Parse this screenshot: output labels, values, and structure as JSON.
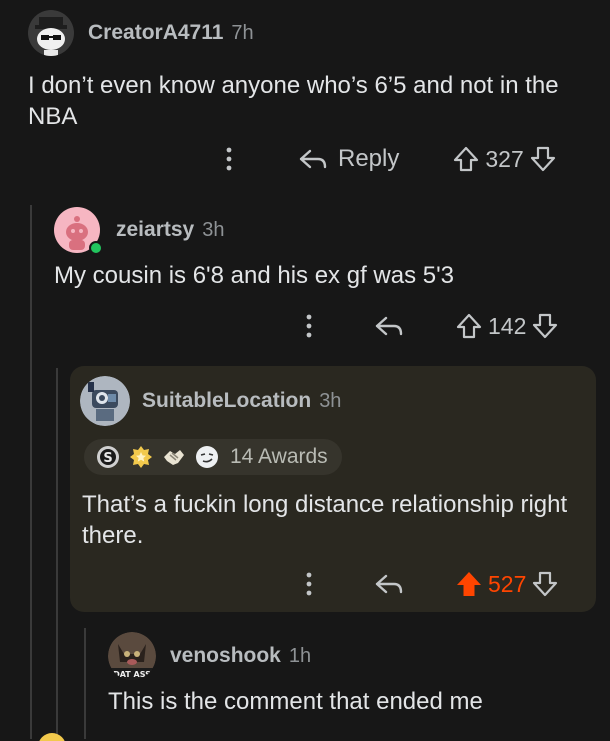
{
  "comments": [
    {
      "username": "CreatorA4711",
      "time": "7h",
      "text": "I don’t even know anyone who’s 6’5 and not in the NBA",
      "reply_label": "Reply",
      "score": "327"
    },
    {
      "username": "zeiartsy",
      "time": "3h",
      "text": "My cousin is 6'8 and his ex gf was 5'3",
      "score": "142"
    },
    {
      "username": "SuitableLocation",
      "time": "3h",
      "awards_label": "14 Awards",
      "text": "That’s a fuckin long distance relationship right there.",
      "score": "527"
    },
    {
      "username": "venoshook",
      "time": "1h",
      "avatar_text": "DAT ASS",
      "text": "This is the comment that ended me"
    }
  ],
  "icons": {
    "more": "more-options-icon",
    "reply": "reply-arrow-icon",
    "upvote": "upvote-icon",
    "downvote": "downvote-icon"
  },
  "colors": {
    "background": "#171717",
    "upvoted": "#ff4500",
    "highlight": "#2a2820"
  }
}
